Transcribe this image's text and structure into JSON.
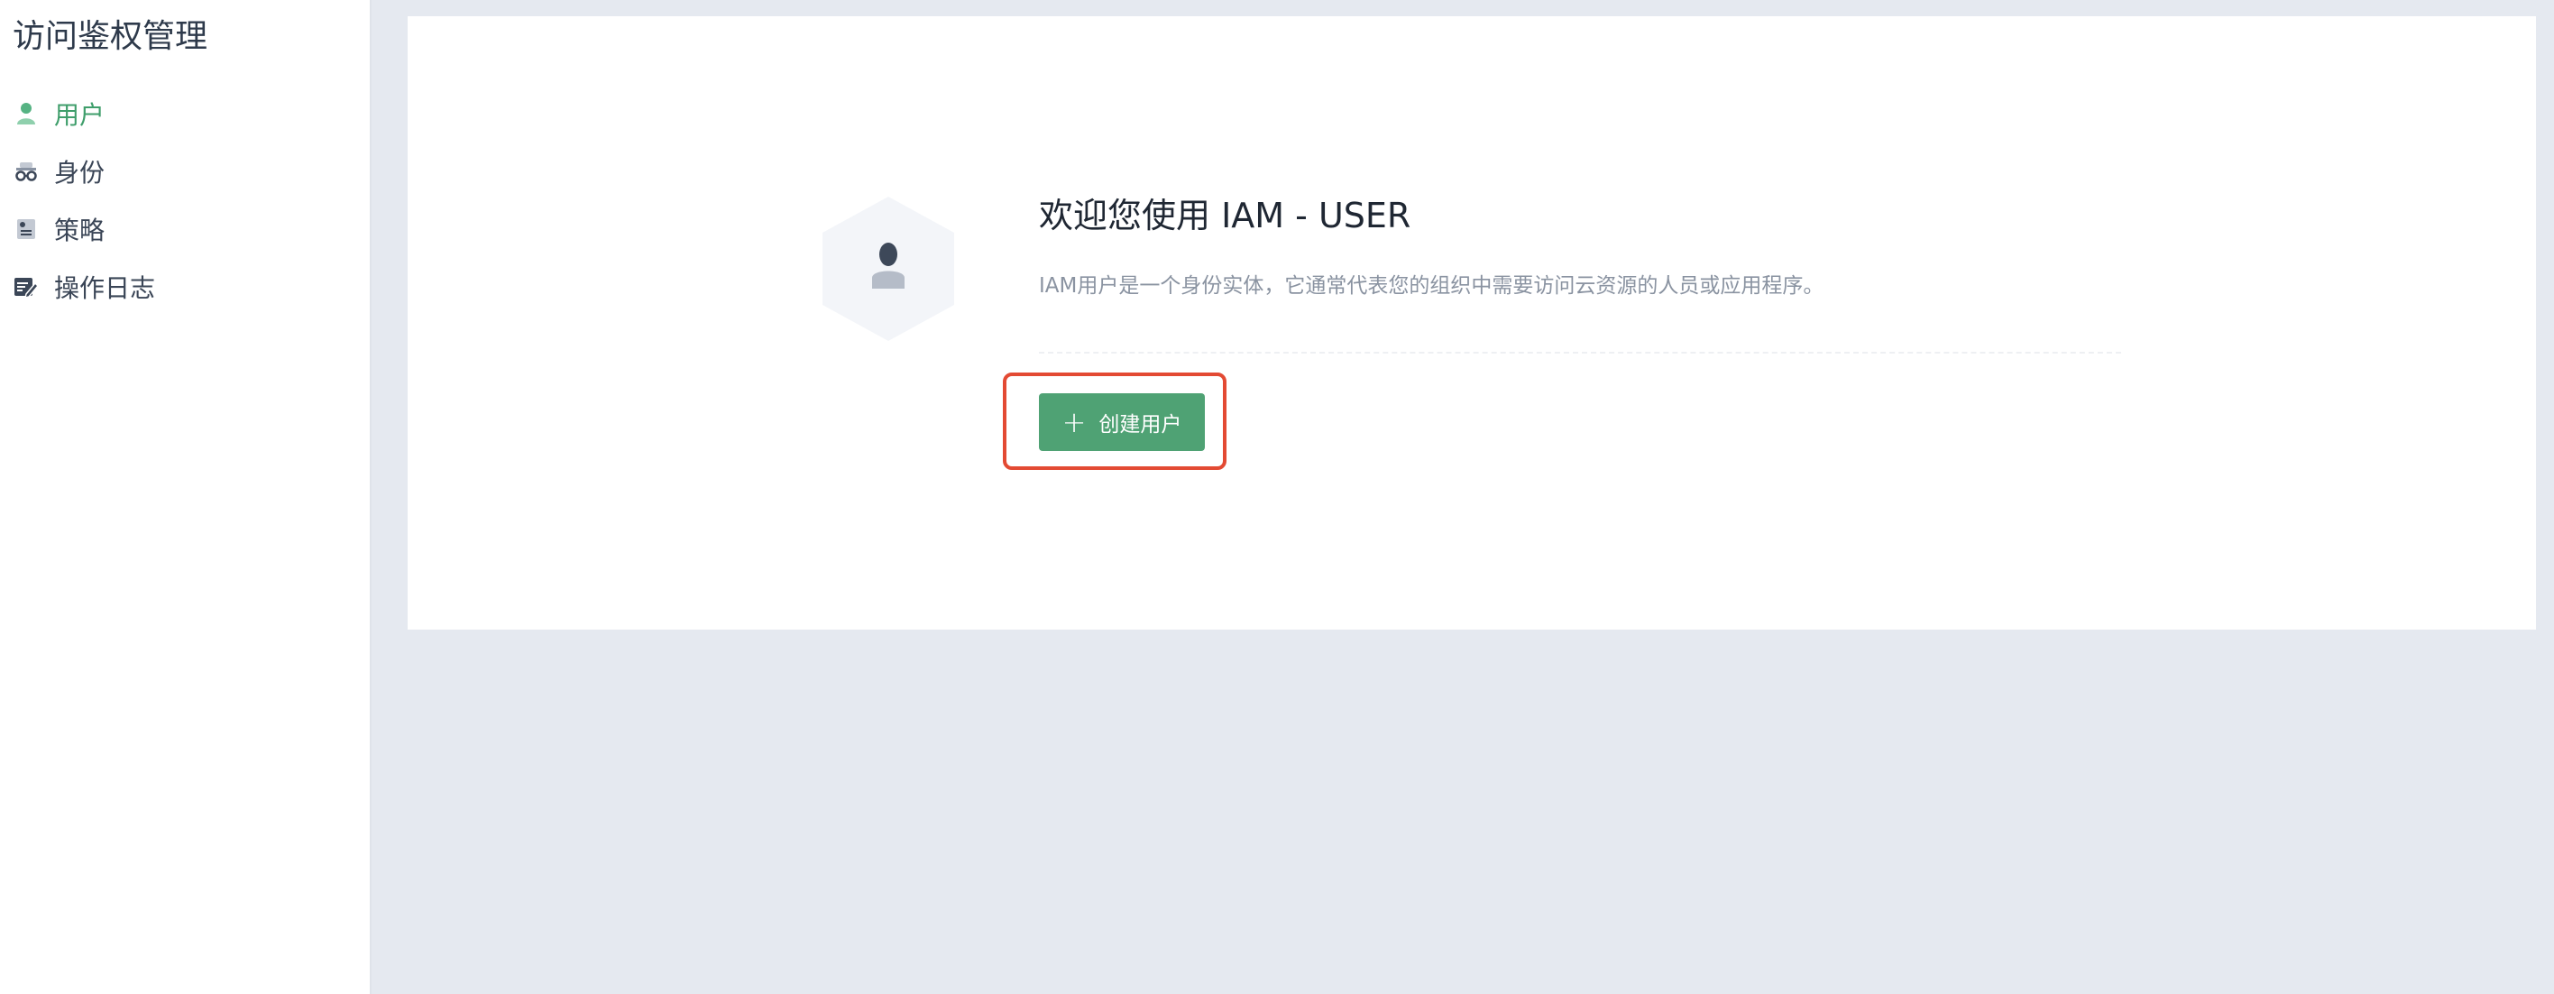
{
  "sidebar": {
    "title": "访问鉴权管理",
    "items": [
      {
        "label": "用户",
        "icon": "user-icon",
        "active": true
      },
      {
        "label": "身份",
        "icon": "identity-icon",
        "active": false
      },
      {
        "label": "策略",
        "icon": "policy-icon",
        "active": false
      },
      {
        "label": "操作日志",
        "icon": "operation-log-icon",
        "active": false
      }
    ]
  },
  "main": {
    "hero_icon": "user-hexagon-icon",
    "title": "欢迎您使用 IAM - USER",
    "description": "IAM用户是一个身份实体，它通常代表您的组织中需要访问云资源的人员或应用程序。",
    "create_button": {
      "icon": "plus-icon",
      "label": "创建用户"
    }
  },
  "colors": {
    "accent": "#4fa274",
    "highlight": "#e34a33",
    "page_background": "#e5e9f0"
  }
}
